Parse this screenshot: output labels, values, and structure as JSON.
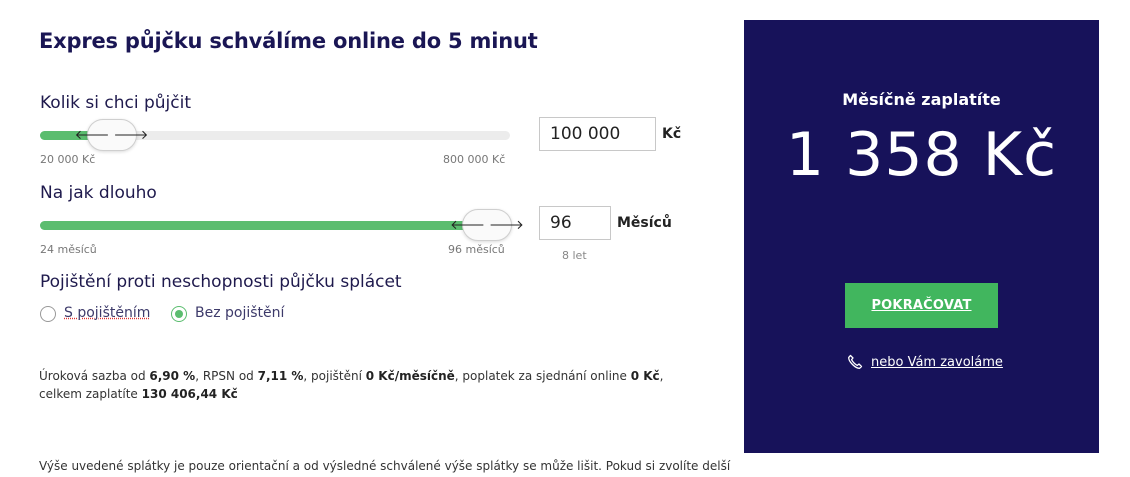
{
  "title": "Expres půjčku schválíme online do 5 minut",
  "amount": {
    "label": "Kolik si chci půjčit",
    "min_label": "20 000 Kč",
    "max_label": "800 000 Kč",
    "value": "100 000",
    "unit": "Kč",
    "slider_fraction": 0.1
  },
  "duration": {
    "label": "Na jak dlouho",
    "min_label": "24 měsíců",
    "max_label": "96 měsíců",
    "value": "96",
    "unit": "Měsíců",
    "hint": "8 let",
    "slider_fraction": 1.0
  },
  "insurance": {
    "label": "Pojištění proti neschopnosti půjčku splácet",
    "options": [
      {
        "label": "S pojištěním",
        "checked": false
      },
      {
        "label": "Bez pojištění",
        "checked": true
      }
    ]
  },
  "terms": {
    "p1": "Úroková sazba od ",
    "rate": "6,90 %",
    "p2": ", RPSN od ",
    "rpsn": "7,11 %",
    "p3": ", pojištění ",
    "insurance": "0 Kč/měsíčně",
    "p4": ", poplatek za sjednání online ",
    "fee": "0 Kč",
    "p5": ", celkem zaplatíte ",
    "total": "130 406,44 Kč"
  },
  "disclaimer": "Výše uvedené splátky je pouze orientační a od výsledné schválené výše splátky se může lišit. Pokud si zvolíte delší",
  "panel": {
    "monthly_label": "Měsíčně zaplatíte",
    "monthly_amount": "1 358 Kč",
    "continue_label": "POKRAČOVAT",
    "callback_label": "nebo Vám zavoláme",
    "phone_icon": "phone-icon"
  },
  "colors": {
    "accent_green": "#41b65e",
    "slider_green": "#5bbd6f",
    "panel_bg": "#17125a",
    "title": "#1a1654"
  }
}
